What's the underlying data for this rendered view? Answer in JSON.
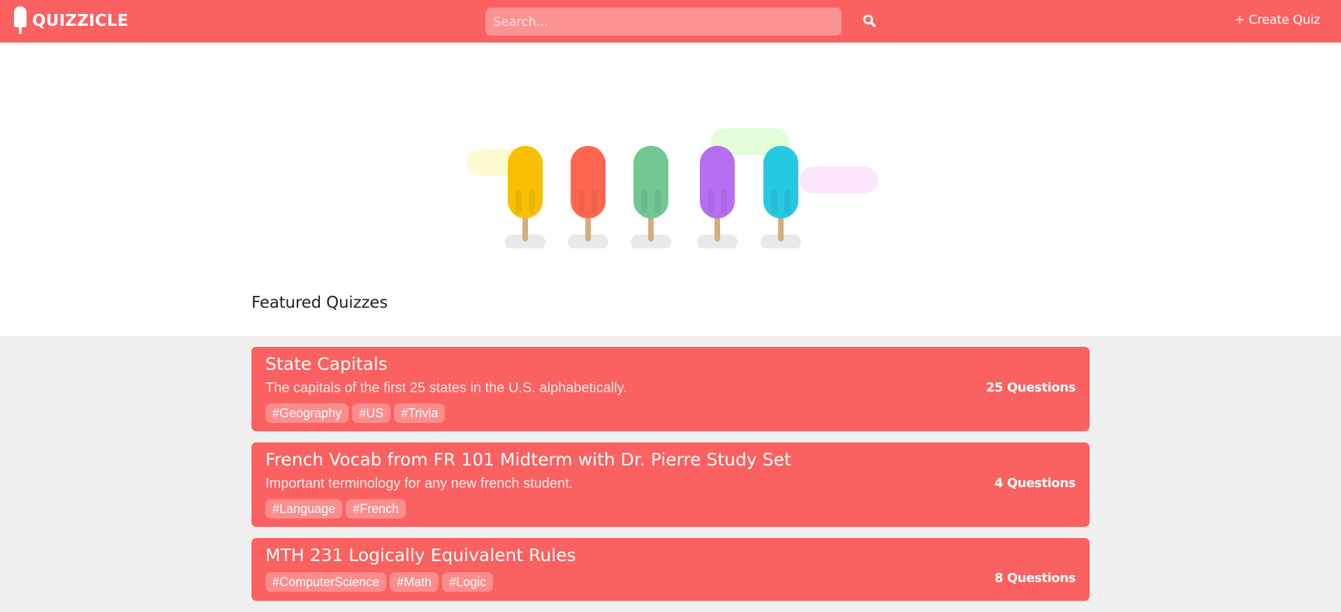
{
  "navbar": {
    "logo_text": "QUIZZICLE",
    "search_placeholder": "Search...",
    "create_label": "+ Create Quiz"
  },
  "hero": {
    "popsicle_colors": [
      "#f8c000",
      "#ff6650",
      "#72c793",
      "#b76ff1",
      "#26c8e2"
    ],
    "cloud_colors": [
      "#fdfbd2",
      "#e2fdd8",
      "#fde0fd"
    ]
  },
  "featured": {
    "title": "Featured Quizzes"
  },
  "quizzes": [
    {
      "title": "State Capitals",
      "description": "The capitals of the first 25 states in the U.S. alphabetically.",
      "count": "25 Questions",
      "tags": [
        "#Geography",
        "#US",
        "#Trivia"
      ]
    },
    {
      "title": "French Vocab from FR 101 Midterm with Dr. Pierre Study Set",
      "description": "Important terminology for any new french student.",
      "count": "4 Questions",
      "tags": [
        "#Language",
        "#French"
      ]
    },
    {
      "title": "MTH 231 Logically Equivalent Rules",
      "description": "",
      "count": "8 Questions",
      "tags": [
        "#ComputerScience",
        "#Math",
        "#Logic"
      ]
    }
  ],
  "colors": {
    "brand": "#fb6161",
    "search_bg": "#fc9393",
    "tag_bg": "#fc8d8d",
    "page_bg": "#f0f0f0"
  }
}
